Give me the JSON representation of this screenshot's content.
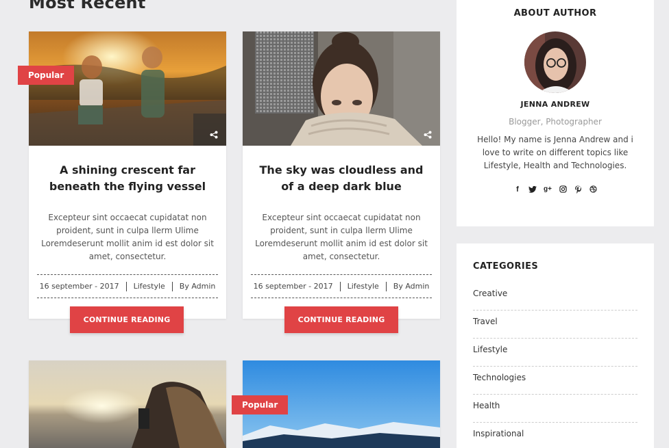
{
  "section": {
    "title": "Most Recent"
  },
  "posts": [
    {
      "badge": "Popular",
      "title": "A shining crescent far beneath the flying vessel",
      "excerpt": "Excepteur sint occaecat cupidatat non proident, sunt in culpa llerm Ulime Loremdeserunt mollit anim id est dolor sit amet, consectetur.",
      "date": "16 september - 2017",
      "category": "Lifestyle",
      "author": "By Admin",
      "button": "CONTINUE READING"
    },
    {
      "badge": "",
      "title": "The sky was cloudless and of a deep dark blue",
      "excerpt": "Excepteur sint occaecat cupidatat non proident, sunt in culpa llerm Ulime Loremdeserunt mollit anim id est dolor sit amet, consectetur.",
      "date": "16 september - 2017",
      "category": "Lifestyle",
      "author": "By Admin",
      "button": "CONTINUE READING"
    },
    {
      "badge": ""
    },
    {
      "badge": "Popular"
    }
  ],
  "author_widget": {
    "title": "ABOUT AUTHOR",
    "name": "JENNA ANDREW",
    "role": "Blogger, Photographer",
    "bio": "Hello! My name is Jenna Andrew and i love to write on different topics like Lifestyle, Health and Technologies.",
    "socials": [
      "facebook-icon",
      "twitter-icon",
      "google-plus-icon",
      "instagram-icon",
      "pinterest-icon",
      "dribbble-icon"
    ]
  },
  "categories_widget": {
    "title": "CATEGORIES",
    "items": [
      "Creative",
      "Travel",
      "Lifestyle",
      "Technologies",
      "Health",
      "Inspirational"
    ]
  },
  "colors": {
    "accent": "#e04345",
    "background": "#ececee"
  }
}
